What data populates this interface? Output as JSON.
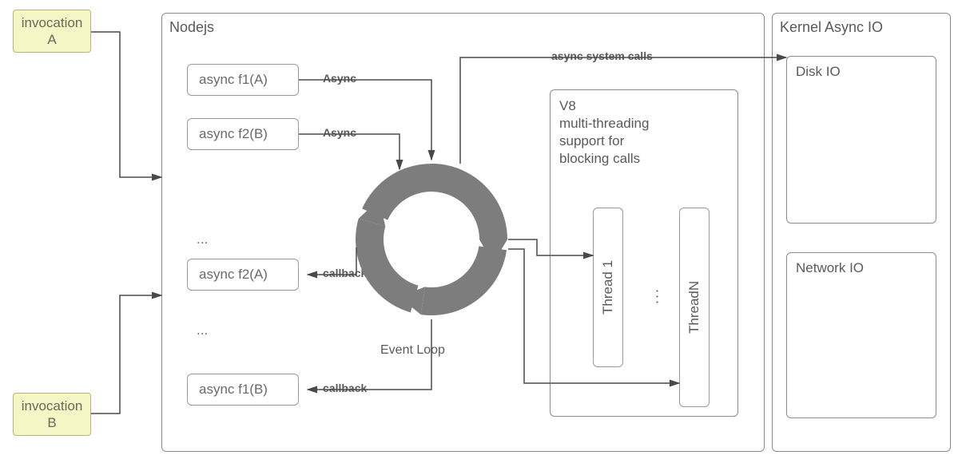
{
  "invocation_a": "invocation\nA",
  "invocation_b": "invocation\nB",
  "nodejs_title": "Nodejs",
  "kernel_title": "Kernel Async IO",
  "disk_io": "Disk IO",
  "network_io": "Network IO",
  "v8_caption": "V8\nmulti-threading\nsupport for\nblocking calls",
  "thread1": "Thread 1",
  "threadn": "ThreadN",
  "thread_ellipsis": "...",
  "fn": {
    "f1a": "async f1(A)",
    "f2b": "async f2(B)",
    "f2a": "async f2(A)",
    "f1b": "async f1(B)"
  },
  "ellipsis_top": "...",
  "ellipsis_bottom": "...",
  "edge_async1": "Async",
  "edge_async2": "Async",
  "edge_cb1": "callback",
  "edge_cb2": "callback",
  "edge_syscalls": "async system calls",
  "event_loop_label": "Event Loop"
}
